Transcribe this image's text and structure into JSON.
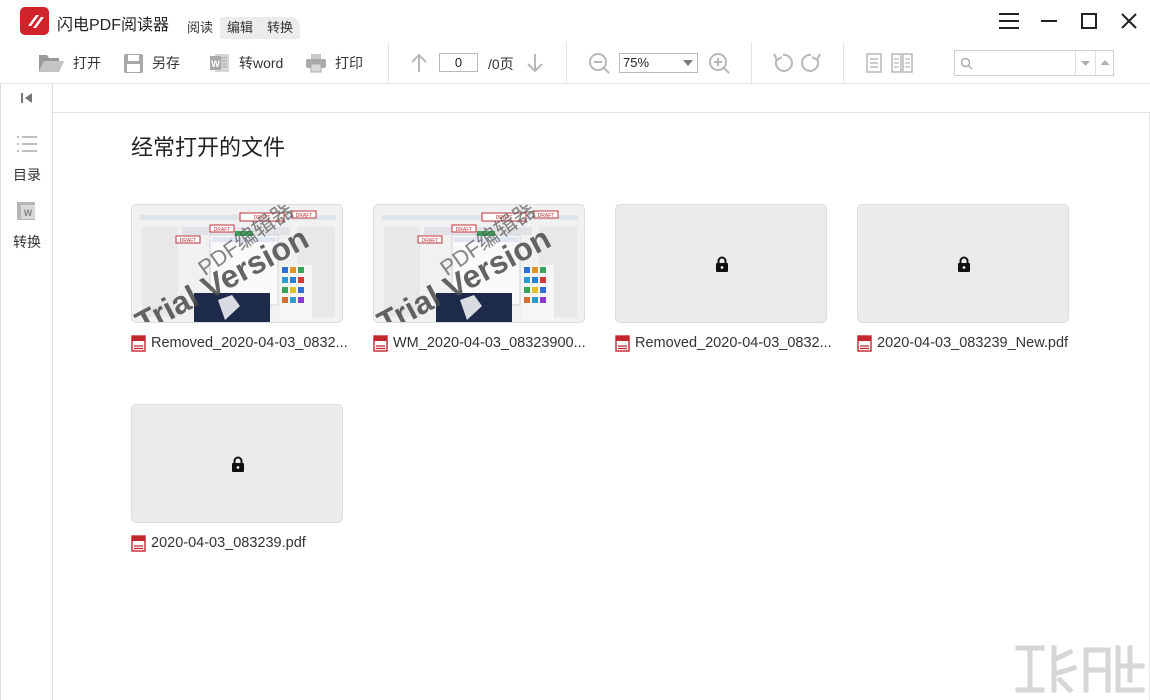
{
  "app": {
    "title": "闪电PDF阅读器",
    "accent": "#d0232a"
  },
  "menu": {
    "tabs": [
      {
        "label": "阅读"
      },
      {
        "label": "编辑"
      },
      {
        "label": "转换"
      }
    ]
  },
  "window_controls": [
    "menu-icon",
    "minimize-icon",
    "maximize-icon",
    "close-icon"
  ],
  "toolbar": {
    "open_label": "打开",
    "saveas_label": "另存",
    "toword_label": "转word",
    "print_label": "打印",
    "page_current": "0",
    "page_total": "/0页",
    "zoom": "75%",
    "search_placeholder": ""
  },
  "sidebar": {
    "items": [
      {
        "label": "目录",
        "icon": "outline-icon"
      },
      {
        "label": "转换",
        "icon": "convert-icon"
      }
    ]
  },
  "main": {
    "title": "经常打开的文件",
    "files": [
      {
        "name": "Removed_2020-04-03_0832...",
        "thumbnail": "preview"
      },
      {
        "name": "WM_2020-04-03_08323900...",
        "thumbnail": "preview"
      },
      {
        "name": "Removed_2020-04-03_0832...",
        "thumbnail": "locked"
      },
      {
        "name": "2020-04-03_083239_New.pdf",
        "thumbnail": "locked"
      },
      {
        "name": "2020-04-03_083239.pdf",
        "thumbnail": "locked"
      }
    ],
    "preview_watermark": "Trial Version",
    "preview_watermark_cn": "PDF编辑器",
    "preview_stamp": "DRAFT"
  }
}
